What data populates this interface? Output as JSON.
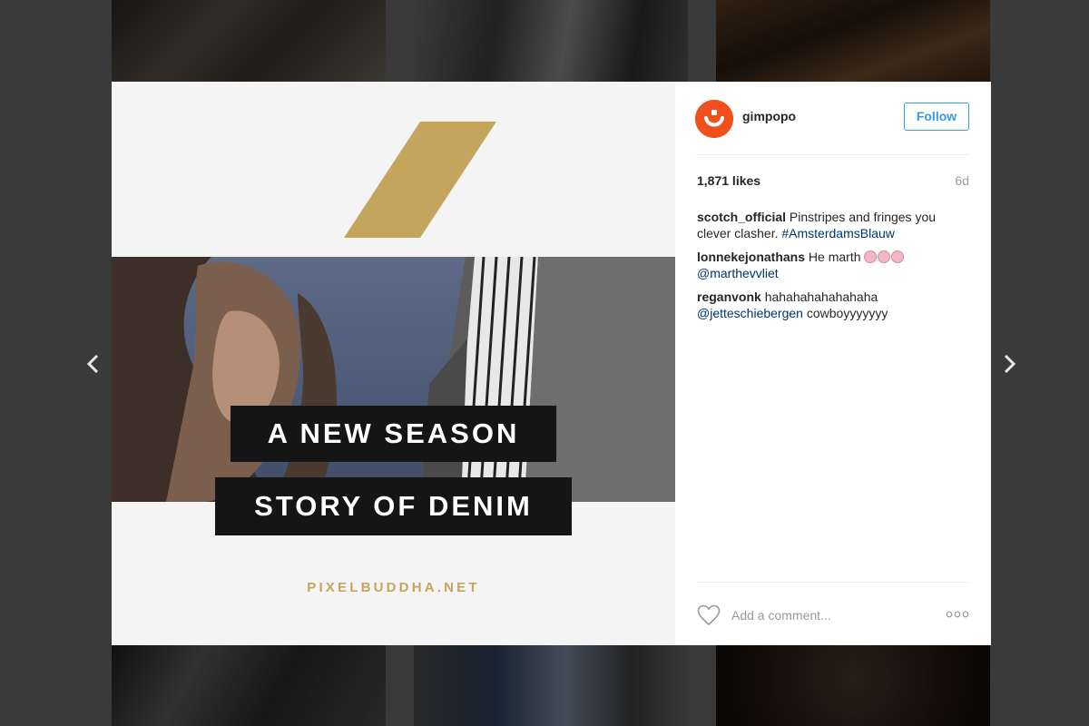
{
  "gallery": {
    "thumbnails_top": [
      "thumb-top-1",
      "thumb-top-2",
      "thumb-top-3"
    ],
    "thumbnails_bottom": [
      "thumb-bottom-1",
      "thumb-bottom-2",
      "thumb-bottom-3"
    ]
  },
  "navigation": {
    "prev_icon": "chevron-left-icon",
    "next_icon": "chevron-right-icon"
  },
  "post": {
    "image": {
      "headline_1": "A NEW SEASON",
      "headline_2": "STORY OF DENIM",
      "site": "PIXELBUDDHA.NET"
    },
    "author": {
      "username": "gimpopo",
      "avatar_icon": "smiley-logo-icon",
      "follow_label": "Follow"
    },
    "likes": "1,871 likes",
    "age": "6d",
    "comments": [
      {
        "user": "scotch_official",
        "text": "Pinstripes and fringes you clever clasher.",
        "link": "#AmsterdamsBlauw"
      },
      {
        "user": "lonnekejonathans",
        "text": "He marth",
        "link": "@marthevvliet"
      },
      {
        "user": "reganvonk",
        "text": "hahahahahahahaha",
        "link": "@jetteschiebergen",
        "after": "cowboyyyyyyy"
      }
    ],
    "comment_placeholder": "Add a comment...",
    "heart_icon": "heart-icon",
    "more_icon": "more-options-icon"
  },
  "colors": {
    "accent": "#3897f0",
    "brand": "#f0501e",
    "gold": "#c4a55e"
  }
}
